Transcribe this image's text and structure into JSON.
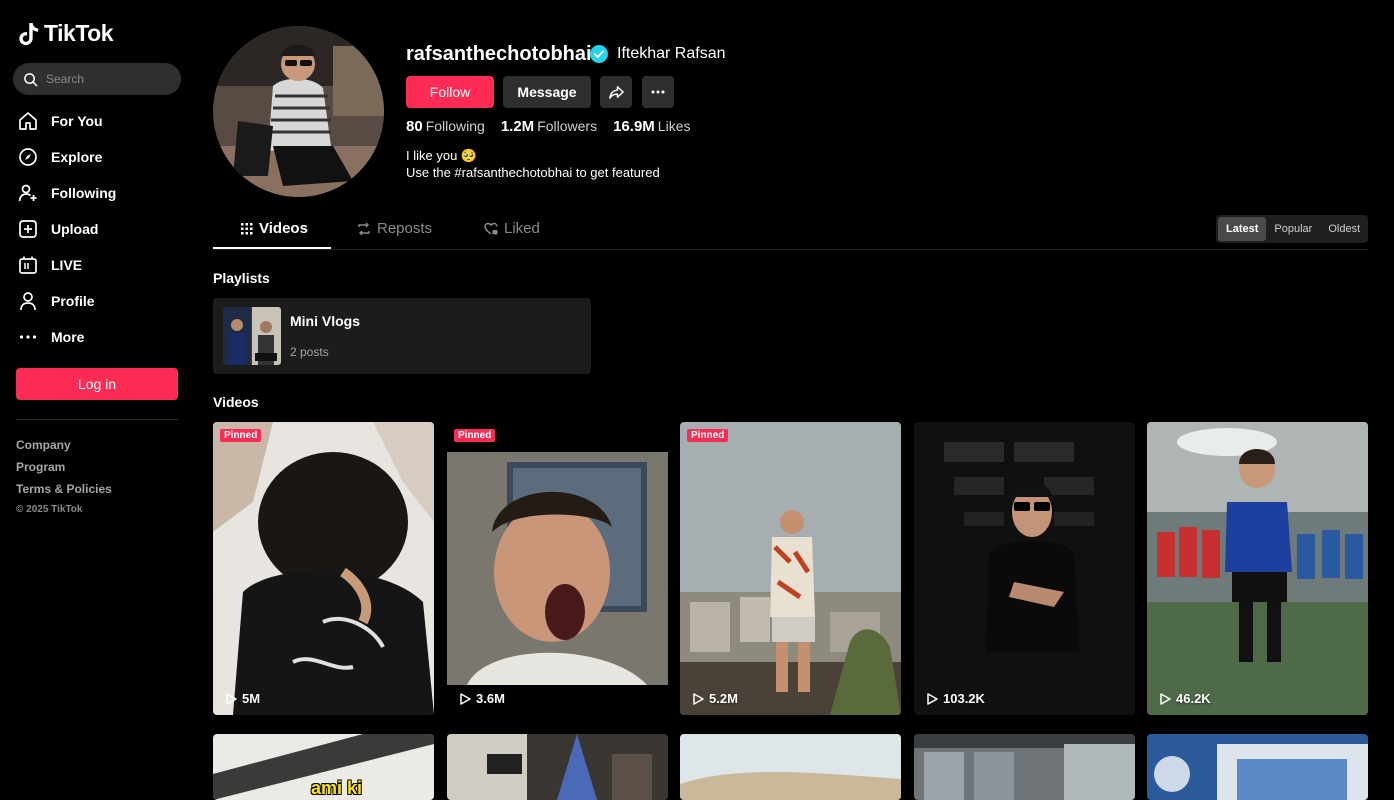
{
  "brand": {
    "name": "TikTok"
  },
  "search": {
    "placeholder": "Search"
  },
  "nav": {
    "items": [
      {
        "label": "For You",
        "icon": "home-icon"
      },
      {
        "label": "Explore",
        "icon": "compass-icon"
      },
      {
        "label": "Following",
        "icon": "user-plus-icon"
      },
      {
        "label": "Upload",
        "icon": "plus-square-icon"
      },
      {
        "label": "LIVE",
        "icon": "live-tv-icon"
      },
      {
        "label": "Profile",
        "icon": "person-icon"
      },
      {
        "label": "More",
        "icon": "more-dots-icon"
      }
    ]
  },
  "login": {
    "label": "Log in"
  },
  "footer": {
    "links": [
      "Company",
      "Program",
      "Terms & Policies"
    ],
    "copyright": "© 2025 TikTok"
  },
  "profile": {
    "username": "rafsanthechotobhai",
    "nickname": "Iftekhar Rafsan",
    "follow_label": "Follow",
    "message_label": "Message",
    "following_count": "80",
    "following_label": "Following",
    "followers_count": "1.2M",
    "followers_label": "Followers",
    "likes_count": "16.9M",
    "likes_label": "Likes",
    "bio_line1": "I like you 🥺",
    "bio_line2": "Use the #rafsanthechotobhai to get featured"
  },
  "tabs": {
    "videos": "Videos",
    "reposts": "Reposts",
    "liked": "Liked"
  },
  "sort": {
    "latest": "Latest",
    "popular": "Popular",
    "oldest": "Oldest"
  },
  "sections": {
    "playlists": "Playlists",
    "videos": "Videos"
  },
  "playlist": {
    "name": "Mini Vlogs",
    "count": "2 posts"
  },
  "pinned_label": "Pinned",
  "videos": [
    {
      "views": "5M",
      "pinned": true
    },
    {
      "views": "3.6M",
      "pinned": true
    },
    {
      "views": "5.2M",
      "pinned": true
    },
    {
      "views": "103.2K",
      "pinned": false
    },
    {
      "views": "46.2K",
      "pinned": false
    }
  ],
  "row2_caption": "ami ki",
  "colors": {
    "accent": "#fe2c55",
    "verified": "#20d5ec",
    "surface": "#2f2f2f"
  }
}
